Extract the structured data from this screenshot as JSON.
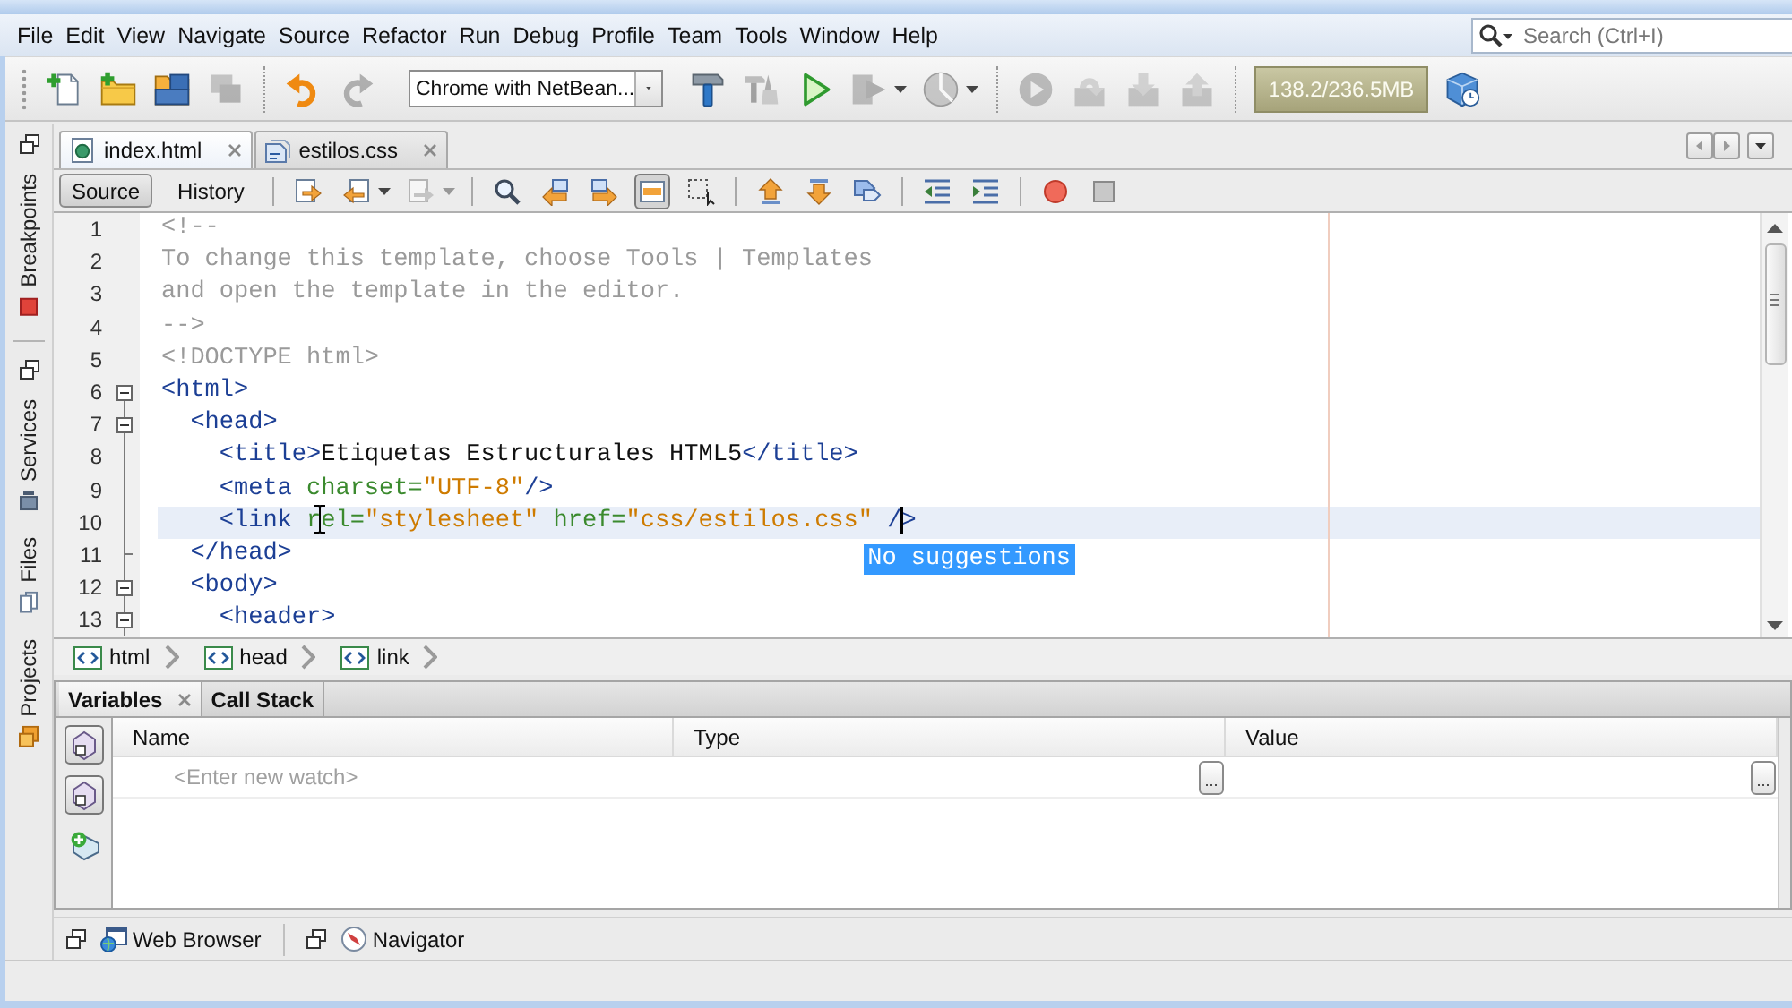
{
  "menu": {
    "items": [
      "File",
      "Edit",
      "View",
      "Navigate",
      "Source",
      "Refactor",
      "Run",
      "Debug",
      "Profile",
      "Team",
      "Tools",
      "Window",
      "Help"
    ]
  },
  "search": {
    "placeholder": "Search (Ctrl+I)"
  },
  "toolbar": [
    {
      "kind": "new-file",
      "disabled": false,
      "menu": false
    },
    {
      "kind": "new-project",
      "disabled": false,
      "menu": false
    },
    {
      "kind": "open-project",
      "disabled": false,
      "menu": false
    },
    {
      "kind": "close-project",
      "disabled": true,
      "menu": false
    },
    {
      "kind": "separator"
    },
    {
      "kind": "undo",
      "disabled": false,
      "menu": false
    },
    {
      "kind": "redo",
      "disabled": true,
      "menu": false
    },
    {
      "kind": "browser-select",
      "value": "Chrome with NetBean..."
    },
    {
      "kind": "build",
      "disabled": false,
      "menu": false
    },
    {
      "kind": "clean-build",
      "disabled": true,
      "menu": false
    },
    {
      "kind": "run",
      "disabled": false,
      "menu": false
    },
    {
      "kind": "debug",
      "disabled": true,
      "menu": true
    },
    {
      "kind": "profile",
      "disabled": true,
      "menu": true
    },
    {
      "kind": "separator"
    },
    {
      "kind": "continue",
      "disabled": true,
      "menu": false
    },
    {
      "kind": "step-over",
      "disabled": true,
      "menu": false
    },
    {
      "kind": "step-into",
      "disabled": true,
      "menu": false
    },
    {
      "kind": "step-out",
      "disabled": true,
      "menu": false
    },
    {
      "kind": "separator"
    },
    {
      "kind": "memory",
      "value": "138.2/236.5MB"
    },
    {
      "kind": "gc",
      "disabled": false,
      "menu": false
    }
  ],
  "side": {
    "groups": [
      {
        "tabs": [
          {
            "label": "Breakpoints",
            "kind": "breakpoints",
            "selected": false
          }
        ]
      },
      {
        "tabs": [
          {
            "label": "Services",
            "kind": "services",
            "selected": false
          },
          {
            "label": "Files",
            "kind": "files",
            "selected": false
          },
          {
            "label": "Projects",
            "kind": "projects",
            "selected": false
          }
        ]
      }
    ]
  },
  "editor": {
    "tabs": [
      {
        "label": "index.html",
        "kind": "html",
        "selected": true
      },
      {
        "label": "estilos.css",
        "kind": "css",
        "selected": false
      }
    ],
    "views": [
      {
        "label": "Source",
        "selected": true
      },
      {
        "label": "History",
        "selected": false
      }
    ],
    "tools": [
      {
        "kind": "last-edit",
        "disabled": false,
        "pressed": false,
        "menu": false
      },
      {
        "kind": "back",
        "disabled": false,
        "pressed": false,
        "menu": true
      },
      {
        "kind": "forward",
        "disabled": true,
        "pressed": false,
        "menu": true
      },
      {
        "kind": "separator"
      },
      {
        "kind": "find",
        "disabled": false,
        "pressed": false,
        "menu": false
      },
      {
        "kind": "find-previous",
        "disabled": false,
        "pressed": false,
        "menu": false
      },
      {
        "kind": "find-next",
        "disabled": false,
        "pressed": false,
        "menu": false
      },
      {
        "kind": "highlight",
        "disabled": false,
        "pressed": true,
        "menu": false
      },
      {
        "kind": "rect-select",
        "disabled": false,
        "pressed": false,
        "menu": false
      },
      {
        "kind": "separator"
      },
      {
        "kind": "bookmark-previous",
        "disabled": false,
        "pressed": false,
        "menu": false
      },
      {
        "kind": "bookmark-next",
        "disabled": false,
        "pressed": false,
        "menu": false
      },
      {
        "kind": "bookmark-toggle",
        "disabled": false,
        "pressed": false,
        "menu": false
      },
      {
        "kind": "separator"
      },
      {
        "kind": "shift-left",
        "disabled": false,
        "pressed": false,
        "menu": false
      },
      {
        "kind": "shift-right",
        "disabled": false,
        "pressed": false,
        "menu": false
      },
      {
        "kind": "separator"
      },
      {
        "kind": "record-macro",
        "disabled": false,
        "pressed": false,
        "menu": false
      },
      {
        "kind": "stop-macro",
        "disabled": false,
        "pressed": false,
        "menu": false
      }
    ],
    "lines": [
      {
        "number": "1",
        "current": false,
        "kind": "plain",
        "tokens": [
          {
            "kind": "comment",
            "text": "<!--"
          }
        ]
      },
      {
        "number": "2",
        "current": false,
        "kind": "plain",
        "tokens": [
          {
            "kind": "comment",
            "text": "To change this template, choose Tools | Templates"
          }
        ]
      },
      {
        "number": "3",
        "current": false,
        "kind": "plain",
        "tokens": [
          {
            "kind": "comment",
            "text": "and open the template in the editor."
          }
        ]
      },
      {
        "number": "4",
        "current": false,
        "kind": "plain",
        "tokens": [
          {
            "kind": "comment",
            "text": "-->"
          }
        ]
      },
      {
        "number": "5",
        "current": false,
        "kind": "plain",
        "tokens": [
          {
            "kind": "doctype",
            "text": "<!DOCTYPE html>"
          }
        ]
      },
      {
        "number": "6",
        "current": false,
        "kind": "fold-start",
        "tokens": [
          {
            "kind": "tag",
            "text": "<html>"
          }
        ]
      },
      {
        "number": "7",
        "current": false,
        "kind": "fold-start",
        "tokens": [
          {
            "kind": "tag",
            "text": "  <head>"
          }
        ]
      },
      {
        "number": "8",
        "current": false,
        "kind": "fold-inner",
        "tokens": [
          {
            "kind": "tag",
            "text": "    <title>"
          },
          {
            "kind": "text",
            "text": "Etiquetas Estructurales HTML5"
          },
          {
            "kind": "tag",
            "text": "</title>"
          }
        ]
      },
      {
        "number": "9",
        "current": false,
        "kind": "fold-inner",
        "tokens": [
          {
            "kind": "tag",
            "text": "    <meta"
          },
          {
            "kind": "attr",
            "text": " charset="
          },
          {
            "kind": "value",
            "text": "\"UTF-8\""
          },
          {
            "kind": "tag",
            "text": "/>"
          }
        ]
      },
      {
        "number": "10",
        "current": true,
        "kind": "fold-inner",
        "tokens": [
          {
            "kind": "tag",
            "text": "    <link"
          },
          {
            "kind": "attr",
            "text": " rel="
          },
          {
            "kind": "value",
            "text": "\"stylesheet\""
          },
          {
            "kind": "attr",
            "text": " href="
          },
          {
            "kind": "value",
            "text": "\"css/estilos.css\""
          },
          {
            "kind": "tag",
            "text": " /"
          },
          {
            "kind": "caret"
          },
          {
            "kind": "tag",
            "text": ">"
          }
        ]
      },
      {
        "number": "11",
        "current": false,
        "kind": "fold-end",
        "tokens": [
          {
            "kind": "tag",
            "text": "  </head>"
          }
        ]
      },
      {
        "number": "12",
        "current": false,
        "kind": "fold-start",
        "tokens": [
          {
            "kind": "tag",
            "text": "  <body>"
          }
        ]
      },
      {
        "number": "13",
        "current": false,
        "kind": "fold-start",
        "tokens": [
          {
            "kind": "tag",
            "text": "    <header>"
          }
        ]
      }
    ],
    "completion_popup": {
      "text": "No suggestions"
    },
    "breadcrumb": [
      "html",
      "head",
      "link"
    ]
  },
  "debug": {
    "tabs": [
      {
        "label": "Variables",
        "selected": true
      },
      {
        "label": "Call Stack",
        "selected": false
      }
    ],
    "tools": [
      {
        "kind": "watch",
        "pressed": true
      },
      {
        "kind": "watch",
        "pressed": true
      },
      {
        "kind": "new-watch",
        "pressed": false
      }
    ],
    "columns": [
      "Name",
      "Type",
      "Value"
    ],
    "watch_row": {
      "placeholder": "<Enter new watch>",
      "type_button": "...",
      "value_button": "..."
    }
  },
  "minimized": [
    {
      "label": "Web Browser",
      "kind": "browser"
    },
    {
      "label": "Navigator",
      "kind": "navigator"
    }
  ]
}
